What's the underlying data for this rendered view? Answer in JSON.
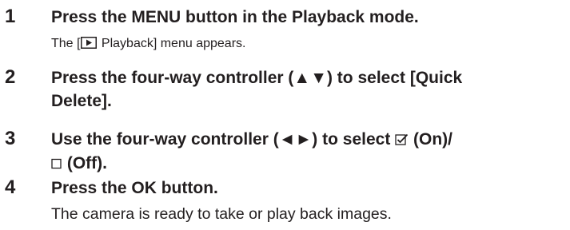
{
  "steps": [
    {
      "number": "1",
      "title": "Press the MENU button in the Playback mode.",
      "desc_before_icon": "The [",
      "desc_icon": "playback-icon",
      "desc_after_icon": " Playback] menu appears."
    },
    {
      "number": "2",
      "title_line1": "Press the four-way controller (▲▼) to select [Quick",
      "title_line2": "Delete]."
    },
    {
      "number": "3",
      "title_part1": "Use the four-way controller (◄►) to select ",
      "on_icon": "checkbox-checked-icon",
      "title_part2": " (On)/",
      "off_icon": "checkbox-empty-icon",
      "title_part3": " (Off)."
    },
    {
      "number": "4",
      "title": "Press the OK button.",
      "desc": "The camera is ready to take or play back images."
    }
  ]
}
